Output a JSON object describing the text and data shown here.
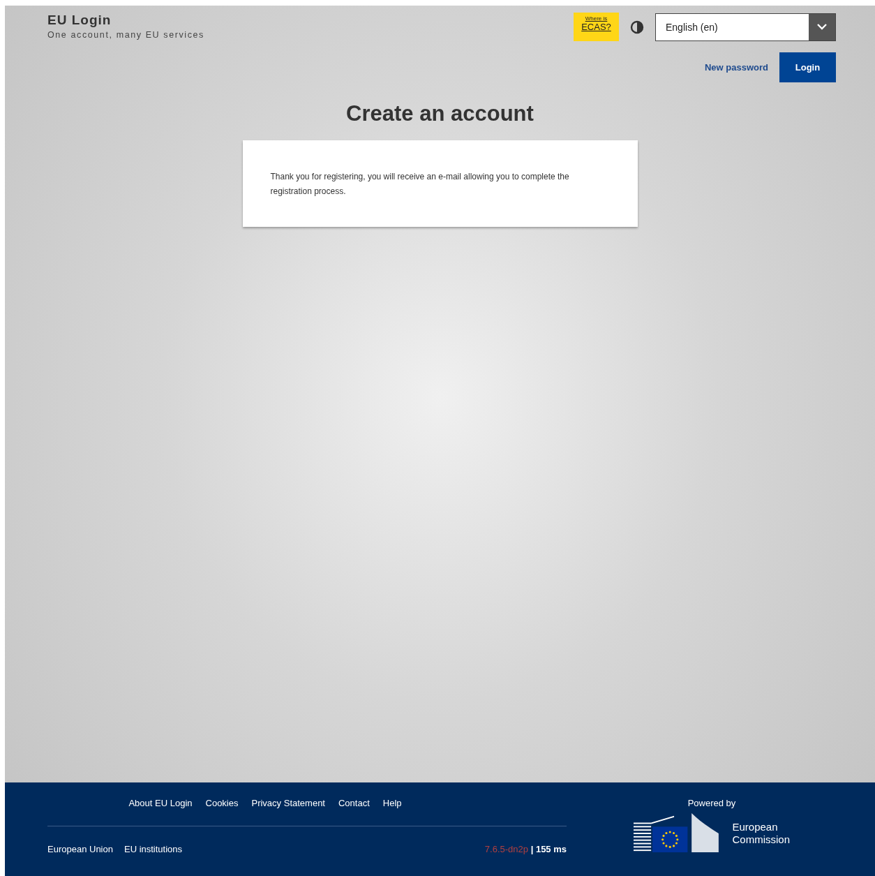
{
  "header": {
    "title": "EU Login",
    "subtitle": "One account, many EU services",
    "ecas": {
      "line1": "Where is",
      "line2": "ECAS?"
    },
    "language": {
      "value": "English (en)"
    }
  },
  "nav": [
    {
      "label": "New password",
      "kind": "link"
    },
    {
      "label": "Login",
      "kind": "button"
    }
  ],
  "main": {
    "heading": "Create an account",
    "message": "Thank you for registering, you will receive an e-mail allowing you to complete the registration process."
  },
  "footer": {
    "links": [
      "About EU Login",
      "Cookies",
      "Privacy Statement",
      "Contact",
      "Help"
    ],
    "bottom_links": [
      "European Union",
      "EU institutions"
    ],
    "version": "7.6.5-dn2p",
    "timing": "| 155 ms",
    "powered_by": "Powered by",
    "logo_text": [
      "European",
      "Commission"
    ]
  }
}
